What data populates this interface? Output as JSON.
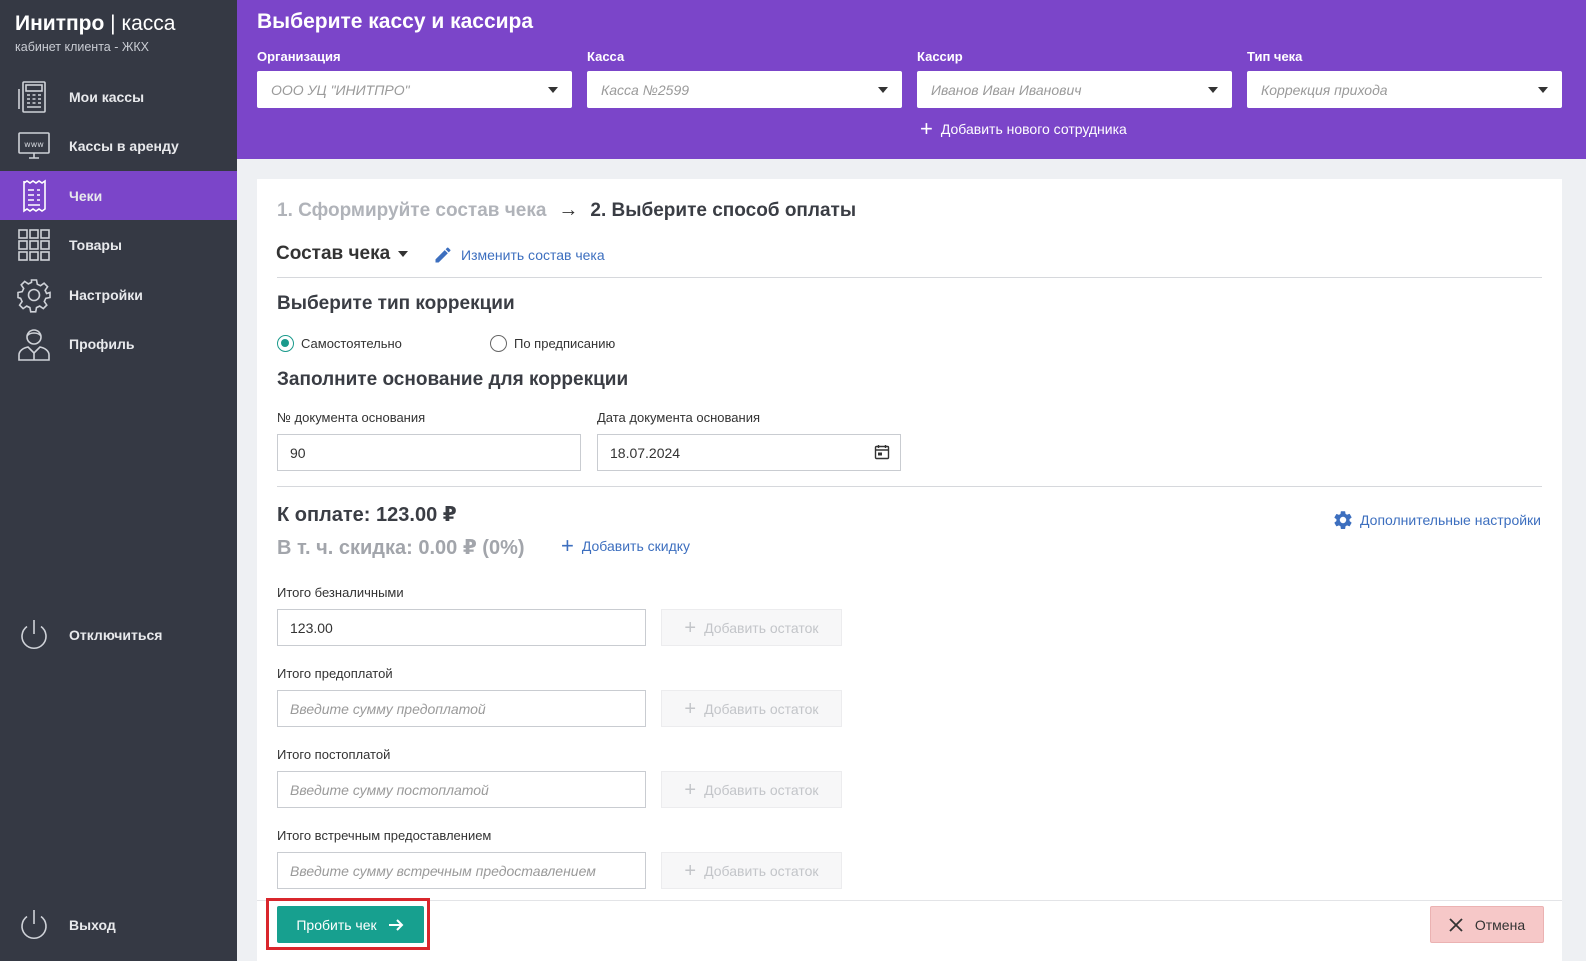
{
  "sidebar": {
    "brand_name": "Инитпро",
    "brand_sep": " | ",
    "brand_product": "касса",
    "brand_sub": "кабинет клиента - ЖКХ",
    "items": [
      {
        "label": "Мои кассы",
        "icon": "cash-register-icon"
      },
      {
        "label": "Кассы в аренду",
        "icon": "www-monitor-icon"
      },
      {
        "label": "Чеки",
        "icon": "receipt-icon",
        "active": true
      },
      {
        "label": "Товары",
        "icon": "grid-icon"
      },
      {
        "label": "Настройки",
        "icon": "gear-icon"
      },
      {
        "label": "Профиль",
        "icon": "user-icon"
      }
    ],
    "disconnect_label": "Отключиться",
    "logout_label": "Выход"
  },
  "header": {
    "title": "Выберите кассу и кассира",
    "fields": [
      {
        "label": "Организация",
        "value": "ООО УЦ \"ИНИТПРО\""
      },
      {
        "label": "Касса",
        "value": "Касса №2599"
      },
      {
        "label": "Кассир",
        "value": "Иванов Иван Иванович"
      },
      {
        "label": "Тип чека",
        "value": "Коррекция прихода"
      }
    ],
    "add_employee": "Добавить нового сотрудника"
  },
  "steps": {
    "step1": "1. Сформируйте состав чека",
    "arrow": "→",
    "step2": "2. Выберите способ оплаты"
  },
  "composition": {
    "title": "Состав чека",
    "edit_label": "Изменить состав чека"
  },
  "correction": {
    "title": "Выберите тип коррекции",
    "option_self": "Самостоятельно",
    "option_order": "По предписанию",
    "selected": "Самостоятельно"
  },
  "basis": {
    "title": "Заполните основание для коррекции",
    "doc_number_label": "№ документа основания",
    "doc_number_value": "90",
    "doc_date_label": "Дата документа основания",
    "doc_date_value": "18.07.2024"
  },
  "payment": {
    "total": "К оплате: 123.00 ₽",
    "discount": "В т. ч. скидка: 0.00 ₽ (0%)",
    "add_discount": "Добавить скидку",
    "extra_settings": "Дополнительные настройки",
    "add_rest_label": "Добавить остаток",
    "cashless_label": "Итого безналичными",
    "cashless_value": "123.00",
    "prepaid_label": "Итого предоплатой",
    "prepaid_placeholder": "Введите сумму предоплатой",
    "postpaid_label": "Итого постоплатой",
    "postpaid_placeholder": "Введите сумму постоплатой",
    "counter_label": "Итого встречным предоставлением",
    "counter_placeholder": "Введите сумму встречным предоставлением"
  },
  "footer": {
    "submit_label": "Пробить чек",
    "cancel_label": "Отмена"
  },
  "colors": {
    "accent": "#7b45c9",
    "sidebar": "#353944",
    "submit": "#17a08f",
    "cancel": "#f6c8c8",
    "link": "#3d6fbf",
    "highlight": "#d9262c"
  }
}
